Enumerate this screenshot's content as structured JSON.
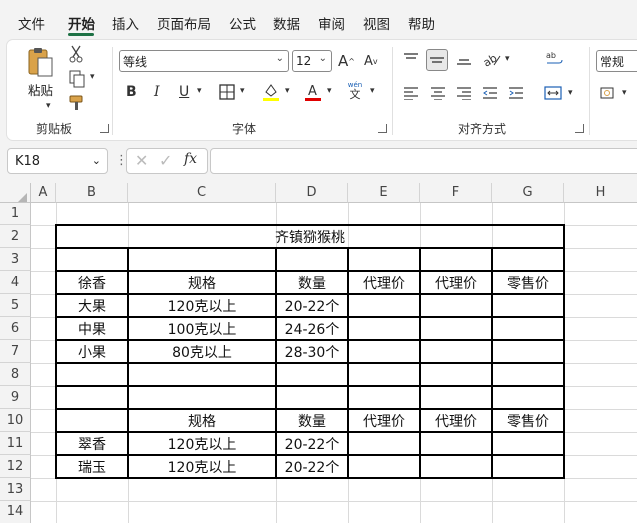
{
  "menu": {
    "items": [
      "文件",
      "开始",
      "插入",
      "页面布局",
      "公式",
      "数据",
      "审阅",
      "视图",
      "帮助"
    ],
    "active": "开始"
  },
  "ribbon": {
    "clipboard": {
      "paste_label": "粘贴",
      "group_label": "剪贴板"
    },
    "font": {
      "font_name": "等线",
      "font_size": "12",
      "group_label": "字体",
      "bold": "B",
      "italic": "I",
      "underline": "U",
      "phonetic_top": "wén",
      "phonetic_bottom": "文"
    },
    "alignment": {
      "group_label": "对齐方式"
    },
    "number": {
      "format": "常规"
    },
    "colors": {
      "accent": "#1e7145",
      "highlight": "#ffff00",
      "font_color": "#e00000"
    }
  },
  "formula_bar": {
    "cell_ref": "K18",
    "fx": "fx",
    "content": ""
  },
  "columns": [
    "A",
    "B",
    "C",
    "D",
    "E",
    "F",
    "G",
    "H"
  ],
  "rows": [
    "1",
    "2",
    "3",
    "4",
    "5",
    "6",
    "7",
    "8",
    "9",
    "10",
    "11",
    "12",
    "13",
    "14"
  ],
  "sheet": {
    "title": "齐镇猕猴桃",
    "section1": {
      "headers": [
        "徐香",
        "规格",
        "数量",
        "代理价",
        "代理价",
        "零售价"
      ],
      "rows": [
        [
          "大果",
          "120克以上",
          "20-22个"
        ],
        [
          "中果",
          "100克以上",
          "24-26个"
        ],
        [
          "小果",
          "80克以上",
          "28-30个"
        ]
      ]
    },
    "section2": {
      "headers": [
        "",
        "规格",
        "数量",
        "代理价",
        "代理价",
        "零售价"
      ],
      "rows": [
        [
          "翠香",
          "120克以上",
          "20-22个"
        ],
        [
          "瑞玉",
          "120克以上",
          "20-22个"
        ]
      ]
    }
  }
}
